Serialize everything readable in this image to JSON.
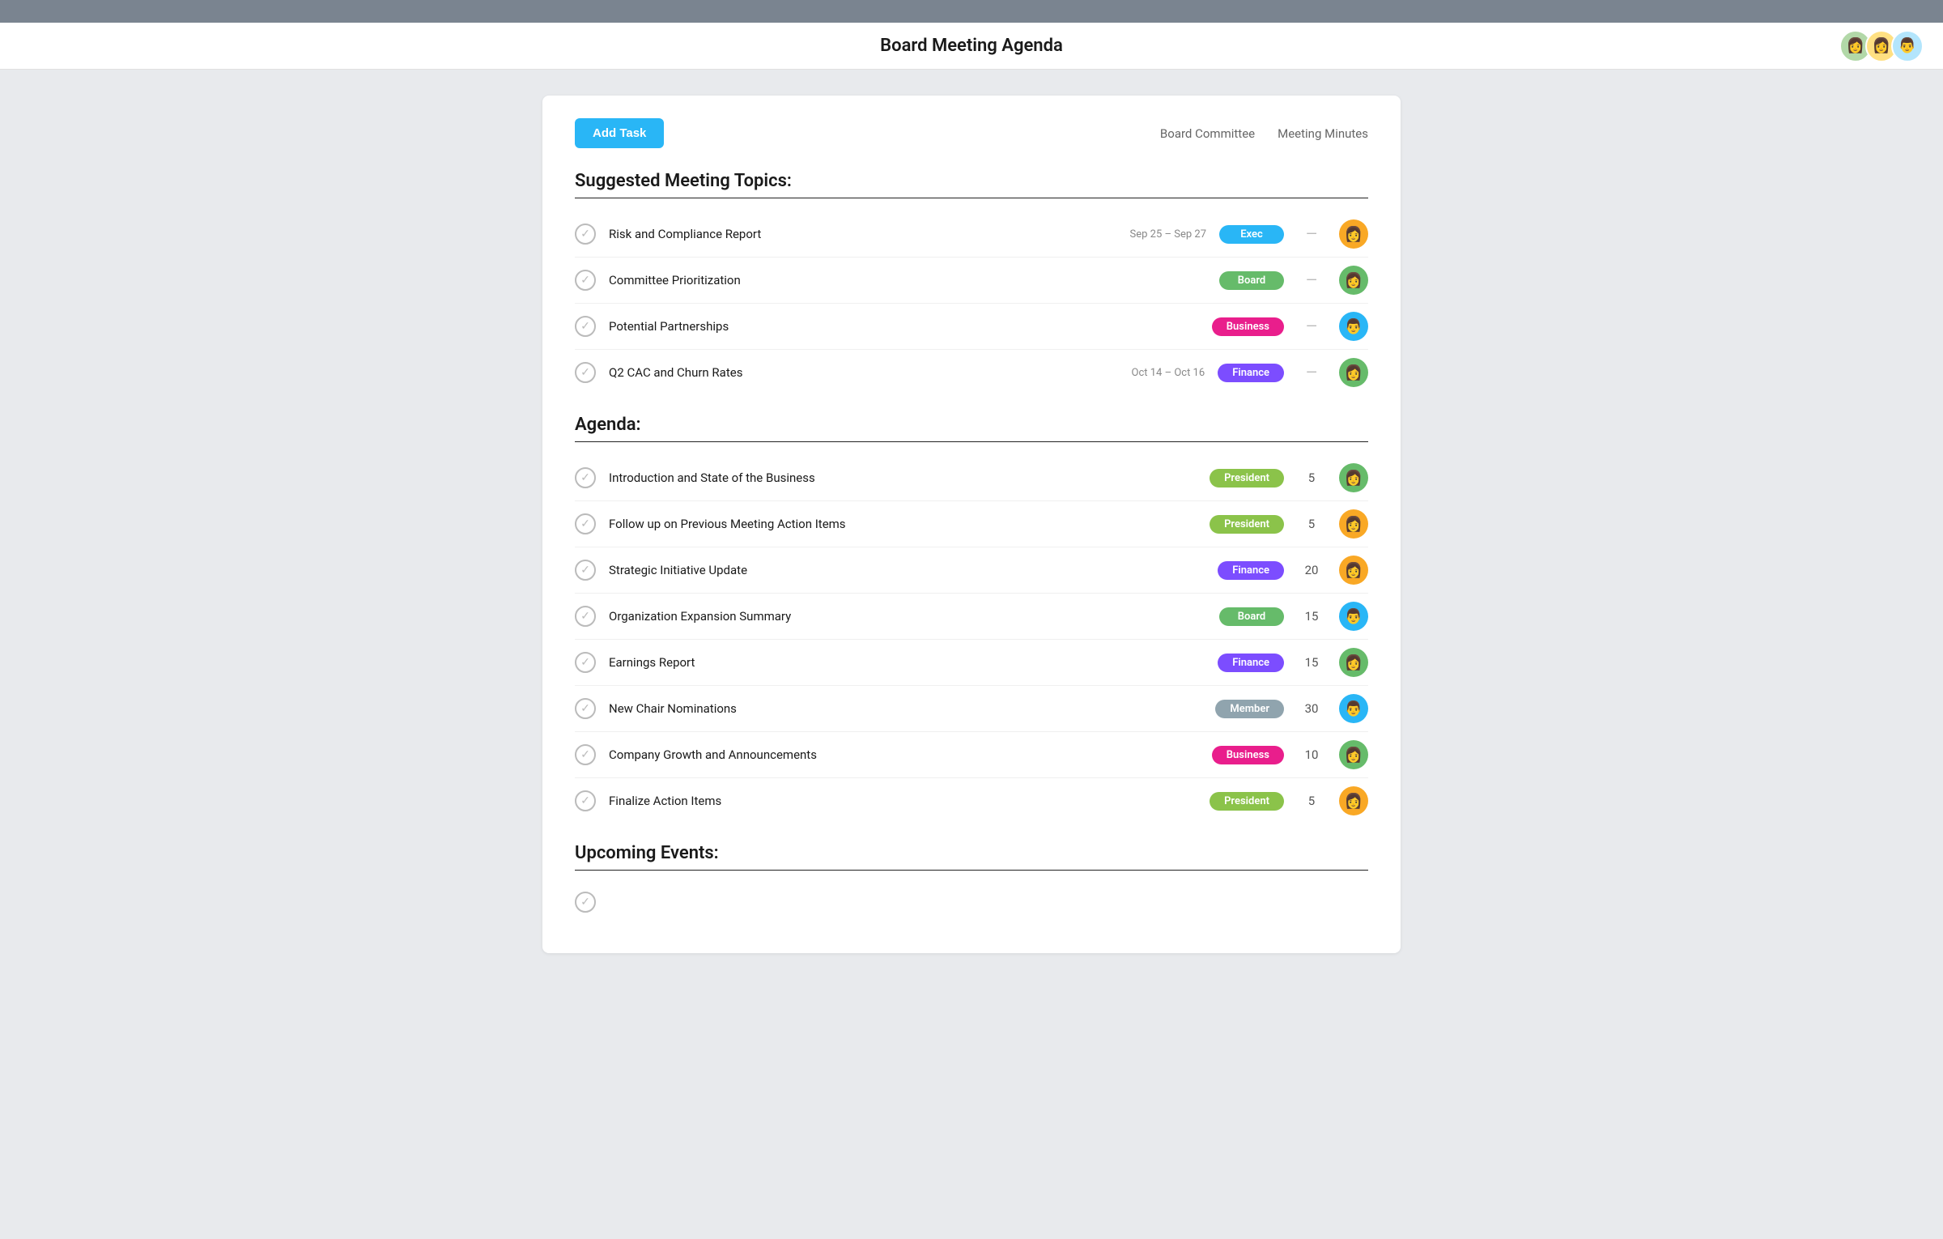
{
  "topbar": {},
  "header": {
    "title": "Board Meeting Agenda",
    "avatars": [
      {
        "color": "#66bb6a",
        "emoji": "👩",
        "bg": "#c8e6c9"
      },
      {
        "color": "#f9a825",
        "emoji": "👩",
        "bg": "#ffe082"
      },
      {
        "color": "#29b6f6",
        "emoji": "👨",
        "bg": "#b3e5fc"
      }
    ]
  },
  "toolbar": {
    "add_task_label": "Add Task",
    "links": [
      {
        "label": "Board Committee",
        "id": "board-committee"
      },
      {
        "label": "Meeting Minutes",
        "id": "meeting-minutes"
      }
    ]
  },
  "suggested_section": {
    "title": "Suggested Meeting Topics:",
    "items": [
      {
        "name": "Risk and Compliance Report",
        "date": "Sep 25 – Sep 27",
        "tag": "Exec",
        "tag_class": "tag-exec",
        "has_duration": false,
        "avatar_emoji": "👩",
        "avatar_bg": "#f9a825"
      },
      {
        "name": "Committee Prioritization",
        "date": "",
        "tag": "Board",
        "tag_class": "tag-board",
        "has_duration": false,
        "avatar_emoji": "👩",
        "avatar_bg": "#66bb6a"
      },
      {
        "name": "Potential Partnerships",
        "date": "",
        "tag": "Business",
        "tag_class": "tag-business",
        "has_duration": false,
        "avatar_emoji": "👨",
        "avatar_bg": "#29b6f6"
      },
      {
        "name": "Q2 CAC and Churn Rates",
        "date": "Oct 14 – Oct 16",
        "tag": "Finance",
        "tag_class": "tag-finance",
        "has_duration": false,
        "avatar_emoji": "👩",
        "avatar_bg": "#66bb6a"
      }
    ]
  },
  "agenda_section": {
    "title": "Agenda:",
    "items": [
      {
        "name": "Introduction and State of the Business",
        "tag": "President",
        "tag_class": "tag-president",
        "duration": "5",
        "avatar_emoji": "👩",
        "avatar_bg": "#66bb6a"
      },
      {
        "name": "Follow up on Previous Meeting Action Items",
        "tag": "President",
        "tag_class": "tag-president",
        "duration": "5",
        "avatar_emoji": "👩",
        "avatar_bg": "#f9a825"
      },
      {
        "name": "Strategic Initiative Update",
        "tag": "Finance",
        "tag_class": "tag-finance",
        "duration": "20",
        "avatar_emoji": "👩",
        "avatar_bg": "#f9a825"
      },
      {
        "name": "Organization Expansion Summary",
        "tag": "Board",
        "tag_class": "tag-board",
        "duration": "15",
        "avatar_emoji": "👨",
        "avatar_bg": "#29b6f6"
      },
      {
        "name": "Earnings Report",
        "tag": "Finance",
        "tag_class": "tag-finance",
        "duration": "15",
        "avatar_emoji": "👩",
        "avatar_bg": "#66bb6a"
      },
      {
        "name": "New Chair Nominations",
        "tag": "Member",
        "tag_class": "tag-member",
        "duration": "30",
        "avatar_emoji": "👨",
        "avatar_bg": "#29b6f6"
      },
      {
        "name": "Company Growth and Announcements",
        "tag": "Business",
        "tag_class": "tag-business",
        "duration": "10",
        "avatar_emoji": "👩",
        "avatar_bg": "#66bb6a"
      },
      {
        "name": "Finalize Action Items",
        "tag": "President",
        "tag_class": "tag-president",
        "duration": "5",
        "avatar_emoji": "👩",
        "avatar_bg": "#f9a825"
      }
    ]
  },
  "upcoming_section": {
    "title": "Upcoming Events:"
  }
}
